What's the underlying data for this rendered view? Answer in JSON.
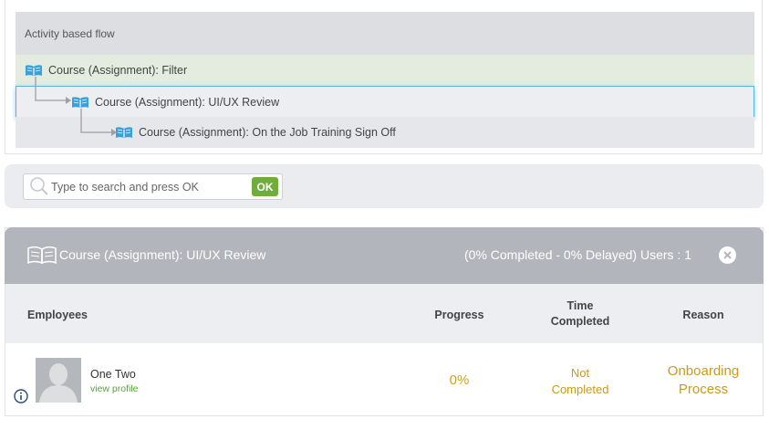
{
  "flow": {
    "title": "Activity based flow",
    "items": [
      {
        "label": "Course (Assignment): Filter"
      },
      {
        "label": "Course (Assignment): UI/UX Review"
      },
      {
        "label": "Course (Assignment): On the Job Training Sign Off"
      }
    ]
  },
  "search": {
    "placeholder": "Type to search and press OK",
    "ok_label": "OK"
  },
  "course": {
    "title": "Course (Assignment): UI/UX Review",
    "stats": "(0% Completed - 0% Delayed) Users : 1",
    "columns": {
      "employees": "Employees",
      "progress": "Progress",
      "time_line1": "Time",
      "time_line2": "Completed",
      "reason": "Reason"
    },
    "rows": [
      {
        "name": "One Two",
        "profile_link": "view profile",
        "progress": "0%",
        "time_line1": "Not",
        "time_line2": "Completed",
        "reason_line1": "Onboarding",
        "reason_line2": "Process"
      }
    ]
  },
  "colors": {
    "accent_green": "#6fae3a",
    "status_gold": "#c99a1c",
    "header_gray": "#b2b6bc",
    "selected_border": "#5ab2e6"
  }
}
